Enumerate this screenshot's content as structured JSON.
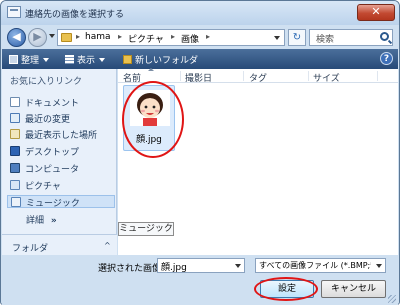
{
  "window": {
    "title": "連絡先の画像を選択する",
    "close_glyph": "✕"
  },
  "address": {
    "crumbs": [
      "hama",
      "ピクチャ",
      "画像"
    ],
    "search_placeholder": "検索"
  },
  "toolbar": {
    "organize": "整理",
    "views": "表示",
    "new_folder": "新しいフォルダ",
    "help": "?"
  },
  "sidebar": {
    "header": "お気に入りリンク",
    "items": [
      {
        "label": "ドキュメント",
        "icon": "documents-icon"
      },
      {
        "label": "最近の変更",
        "icon": "recent-changes-icon"
      },
      {
        "label": "最近表示した場所",
        "icon": "recent-places-icon"
      },
      {
        "label": "デスクトップ",
        "icon": "desktop-icon"
      },
      {
        "label": "コンピュータ",
        "icon": "computer-icon"
      },
      {
        "label": "ピクチャ",
        "icon": "pictures-icon"
      },
      {
        "label": "ミュージック",
        "icon": "music-icon"
      }
    ],
    "more": "詳細",
    "more_chevron": "»",
    "folders": "フォルダ",
    "folders_chevron": "^"
  },
  "columns": [
    "名前",
    "撮影日",
    "タグ",
    "サイズ"
  ],
  "files": [
    {
      "name": "顔.jpg"
    }
  ],
  "tooltip": "ミュージック",
  "footer": {
    "filename_label": "選択された画像:",
    "filename_value": "顔.jpg",
    "filetype_value": "すべての画像ファイル (*.BMP;*.GIF",
    "ok_label": "設定",
    "cancel_label": "キャンセル"
  },
  "colors": {
    "selection": "#dcebfc",
    "annotation": "#e01515",
    "toolbar": "#274a78"
  }
}
